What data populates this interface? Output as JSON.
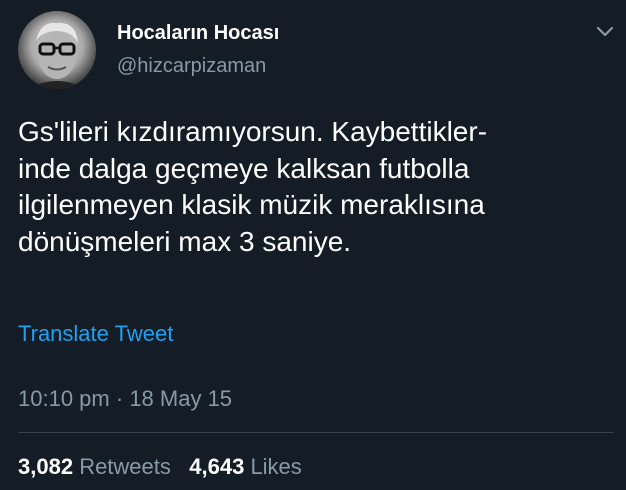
{
  "author": {
    "display_name": "Hocaların Hocası",
    "handle": "@hizcarpizaman",
    "avatar": "profile-photo-man-with-glasses"
  },
  "tweet": {
    "text": "Gs'lileri kızdıramıyorsun. Kaybettikler-\ninde dalga geçmeye kalksan futbolla\nilgilenmeyen klasik müzik meraklısına\ndönüşmeleri max 3 saniye.",
    "translate_label": "Translate Tweet",
    "time": "10:10 pm",
    "separator": "·",
    "date": "18 May 15"
  },
  "stats": {
    "retweets_count": "3,082",
    "retweets_label": "Retweets",
    "likes_count": "4,643",
    "likes_label": "Likes"
  },
  "colors": {
    "background": "#141d26",
    "text_primary": "#ffffff",
    "text_secondary": "#8899a6",
    "link": "#1da1f2",
    "divider": "#38444d"
  },
  "icons": {
    "menu": "chevron-down-icon"
  }
}
